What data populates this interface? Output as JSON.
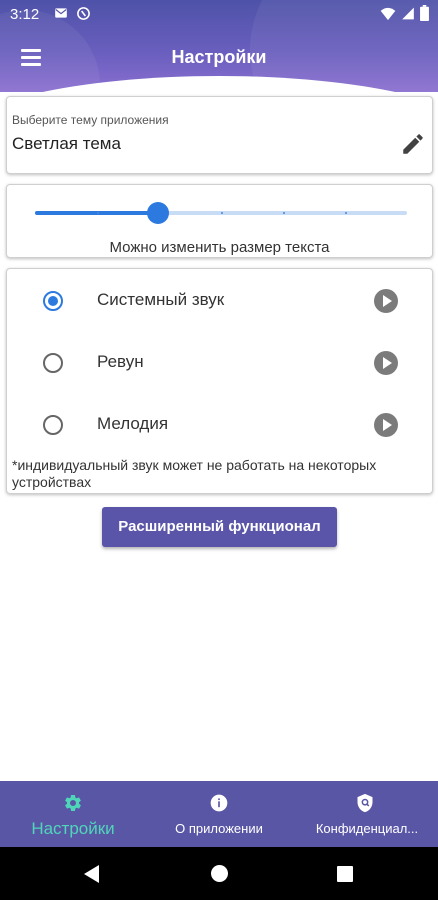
{
  "status_bar": {
    "time": "3:12"
  },
  "app_bar": {
    "title": "Настройки"
  },
  "theme": {
    "label": "Выберите тему приложения",
    "value": "Светлая тема"
  },
  "text_size": {
    "label": "Можно изменить размер текста",
    "level": 0.33,
    "steps": 7
  },
  "sounds": {
    "options": [
      {
        "label": "Системный звук",
        "selected": true
      },
      {
        "label": "Ревун",
        "selected": false
      },
      {
        "label": "Мелодия",
        "selected": false
      }
    ],
    "note": "*индивидуальный звук может не работать на некоторых устройствах"
  },
  "extended_button": {
    "label": "Расширенный функционал"
  },
  "bottom_nav": {
    "items": [
      {
        "label": "Настройки",
        "icon": "gear-icon",
        "active": true
      },
      {
        "label": "О приложении",
        "icon": "info-icon",
        "active": false
      },
      {
        "label": "Конфиденциал...",
        "icon": "privacy-shield-icon",
        "active": false
      }
    ]
  },
  "colors": {
    "accent": "#2c7ae0",
    "header": "#5a56a6",
    "active_tab": "#4fd6b8"
  }
}
